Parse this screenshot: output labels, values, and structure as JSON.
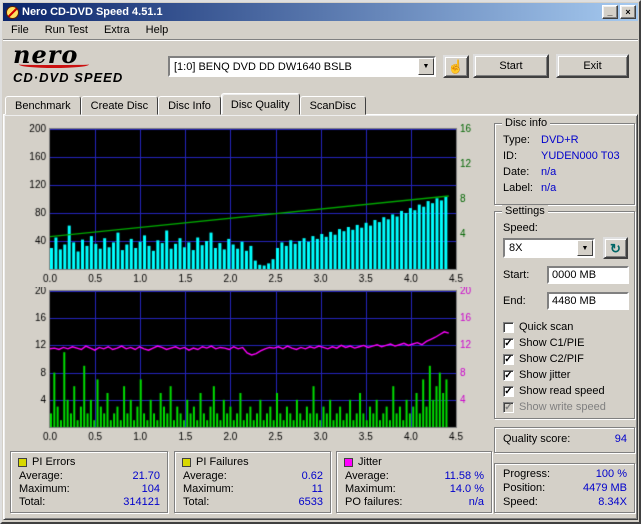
{
  "window": {
    "title": "Nero CD-DVD Speed 4.51.1"
  },
  "glyphs": {
    "check": "✓",
    "dropdown": "▼",
    "refresh": "↻",
    "hand": "☝",
    "minimize": "_",
    "close": "×"
  },
  "menu": {
    "items": [
      "File",
      "Run Test",
      "Extra",
      "Help"
    ]
  },
  "header": {
    "logo_top": "nero",
    "logo_bottom": "CD·DVD SPEED",
    "drive": "[1:0] BENQ DVD DD DW1640 BSLB",
    "start_button": "Start",
    "exit_button": "Exit"
  },
  "tabs": [
    {
      "label": "Benchmark",
      "active": false
    },
    {
      "label": "Create Disc",
      "active": false
    },
    {
      "label": "Disc Info",
      "active": false
    },
    {
      "label": "Disc Quality",
      "active": true
    },
    {
      "label": "ScanDisc",
      "active": false
    }
  ],
  "disc_info": {
    "title": "Disc info",
    "rows": [
      {
        "label": "Type:",
        "value": "DVD+R"
      },
      {
        "label": "ID:",
        "value": "YUDEN000 T03"
      },
      {
        "label": "Date:",
        "value": "n/a"
      },
      {
        "label": "Label:",
        "value": "n/a"
      }
    ]
  },
  "settings": {
    "title": "Settings",
    "speed_label": "Speed:",
    "speed_value": "8X",
    "start_label": "Start:",
    "start_value": "0000 MB",
    "end_label": "End:",
    "end_value": "4480 MB",
    "checkboxes": [
      {
        "label": "Quick scan",
        "checked": false,
        "disabled": false
      },
      {
        "label": "Show C1/PIE",
        "checked": true,
        "disabled": false
      },
      {
        "label": "Show C2/PIF",
        "checked": true,
        "disabled": false
      },
      {
        "label": "Show jitter",
        "checked": true,
        "disabled": false
      },
      {
        "label": "Show read speed",
        "checked": true,
        "disabled": false
      },
      {
        "label": "Show write speed",
        "checked": true,
        "disabled": true
      }
    ]
  },
  "quality": {
    "label": "Quality score:",
    "value": "94"
  },
  "progress": {
    "rows": [
      {
        "label": "Progress:",
        "value": "100 %"
      },
      {
        "label": "Position:",
        "value": "4479 MB"
      },
      {
        "label": "Speed:",
        "value": "8.34X"
      }
    ]
  },
  "stats": [
    {
      "title": "PI Errors",
      "color": "#d8d800",
      "rows": [
        {
          "label": "Average:",
          "value": "21.70"
        },
        {
          "label": "Maximum:",
          "value": "104"
        },
        {
          "label": "Total:",
          "value": "314121"
        }
      ]
    },
    {
      "title": "PI Failures",
      "color": "#d8d800",
      "rows": [
        {
          "label": "Average:",
          "value": "0.62"
        },
        {
          "label": "Maximum:",
          "value": "11"
        },
        {
          "label": "Total:",
          "value": "6533"
        }
      ]
    },
    {
      "title": "Jitter",
      "color": "#ff00ff",
      "rows": [
        {
          "label": "Average:",
          "value": "11.58 %"
        },
        {
          "label": "Maximum:",
          "value": "14.0 %"
        },
        {
          "label": "PO failures:",
          "value": "n/a"
        }
      ]
    }
  ],
  "chart_data": [
    {
      "type": "area",
      "name": "pi-errors-over-position",
      "grid_color": "#2424bc",
      "x_axis": {
        "min": 0,
        "max": 4.5,
        "ticks": [
          "0.0",
          "0.5",
          "1.0",
          "1.5",
          "2.0",
          "2.5",
          "3.0",
          "3.5",
          "4.0",
          "4.5"
        ]
      },
      "left_axis": {
        "min": 0,
        "max": 200,
        "ticks": [
          40,
          80,
          120,
          160,
          200
        ]
      },
      "right_axis": {
        "min": 0,
        "max": 16,
        "ticks": [
          4,
          8,
          12,
          16
        ],
        "color": "#006600"
      },
      "series": [
        {
          "name": "PI Errors (PIE)",
          "style": "bars",
          "color": "#00ffff",
          "axis": "left",
          "x_end": 4.42,
          "values": [
            30,
            45,
            28,
            35,
            62,
            38,
            25,
            42,
            33,
            47,
            36,
            29,
            44,
            31,
            38,
            52,
            27,
            35,
            43,
            30,
            39,
            48,
            33,
            26,
            41,
            37,
            55,
            29,
            36,
            44,
            31,
            38,
            27,
            45,
            34,
            40,
            52,
            30,
            37,
            28,
            43,
            35,
            29,
            39,
            26,
            33,
            12,
            6,
            5,
            8,
            14,
            30,
            38,
            33,
            41,
            36,
            40,
            44,
            39,
            47,
            43,
            50,
            46,
            53,
            49,
            57,
            54,
            60,
            56,
            63,
            59,
            66,
            62,
            70,
            67,
            74,
            71,
            78,
            75,
            83,
            80,
            87,
            84,
            92,
            89,
            97,
            94,
            101,
            98,
            104
          ]
        },
        {
          "name": "Read speed (X)",
          "style": "line",
          "color": "#00aa00",
          "axis": "right",
          "x_end": 4.42,
          "x": [
            0,
            4.42
          ],
          "values": [
            3.7,
            8.34
          ]
        }
      ]
    },
    {
      "type": "bar",
      "name": "pi-failures-and-jitter-over-position",
      "grid_color": "#2424bc",
      "x_axis": {
        "min": 0,
        "max": 4.5,
        "ticks": [
          "0.0",
          "0.5",
          "1.0",
          "1.5",
          "2.0",
          "2.5",
          "3.0",
          "3.5",
          "4.0",
          "4.5"
        ]
      },
      "left_axis": {
        "min": 0,
        "max": 20,
        "ticks": [
          4,
          8,
          12,
          16,
          20
        ]
      },
      "right_axis": {
        "min": 0,
        "max": 20,
        "ticks": [
          4,
          8,
          12,
          16,
          20
        ],
        "color": "#cc00cc"
      },
      "series": [
        {
          "name": "PI Failures (PIF)",
          "style": "bars",
          "color": "#00dd00",
          "axis": "left",
          "x_end": 4.42,
          "values": [
            2,
            8,
            3,
            1,
            11,
            4,
            2,
            6,
            1,
            3,
            9,
            2,
            4,
            1,
            7,
            3,
            2,
            5,
            1,
            2,
            3,
            1,
            6,
            2,
            4,
            1,
            3,
            7,
            2,
            1,
            4,
            2,
            1,
            5,
            3,
            2,
            6,
            1,
            3,
            2,
            1,
            4,
            2,
            3,
            1,
            5,
            2,
            1,
            3,
            6,
            2,
            1,
            4,
            2,
            3,
            1,
            2,
            5,
            1,
            2,
            3,
            1,
            2,
            4,
            1,
            2,
            3,
            1,
            5,
            2,
            1,
            3,
            2,
            1,
            4,
            2,
            1,
            3,
            2,
            6,
            2,
            1,
            3,
            2,
            4,
            1,
            2,
            3,
            1,
            2,
            4,
            1,
            2,
            5,
            2,
            1,
            3,
            2,
            4,
            1,
            2,
            3,
            1,
            6,
            2,
            3,
            1,
            4,
            2,
            3,
            5,
            2,
            7,
            3,
            9,
            4,
            6,
            8,
            5,
            7
          ]
        },
        {
          "name": "Jitter (%)",
          "style": "line",
          "color": "#ff00ff",
          "axis": "right",
          "x_end": 4.42,
          "values": [
            11.5,
            11.6,
            11.4,
            11.7,
            11.5,
            11.8,
            11.6,
            11.4,
            11.9,
            11.6,
            11.3,
            11.7,
            11.5,
            11.8,
            11.4,
            11.6,
            11.9,
            11.5,
            11.7,
            11.4,
            11.8,
            11.5,
            11.3,
            11.6,
            11.9,
            11.7,
            11.4,
            11.6,
            11.8,
            11.5,
            11.7,
            11.3,
            11.6,
            11.4,
            11.8,
            11.6,
            11.9,
            11.5,
            11.7,
            11.6,
            11.4,
            11.8,
            11.5,
            11.7,
            10.9,
            10.6,
            10.8,
            11.2,
            11.5,
            11.7,
            11.6,
            11.8,
            11.5,
            11.9,
            11.6,
            11.4,
            11.7,
            11.5,
            11.8,
            11.6,
            11.9,
            11.7,
            11.5,
            11.8,
            11.6,
            12.0,
            11.7,
            11.9,
            11.6,
            11.8,
            12.0,
            11.7,
            11.9,
            12.1,
            11.8,
            12.0,
            12.2,
            11.9,
            12.1,
            12.3,
            12.0,
            12.2,
            12.4,
            12.1,
            12.6,
            12.9,
            13.2,
            13.6,
            14.0,
            13.8
          ]
        }
      ]
    }
  ]
}
